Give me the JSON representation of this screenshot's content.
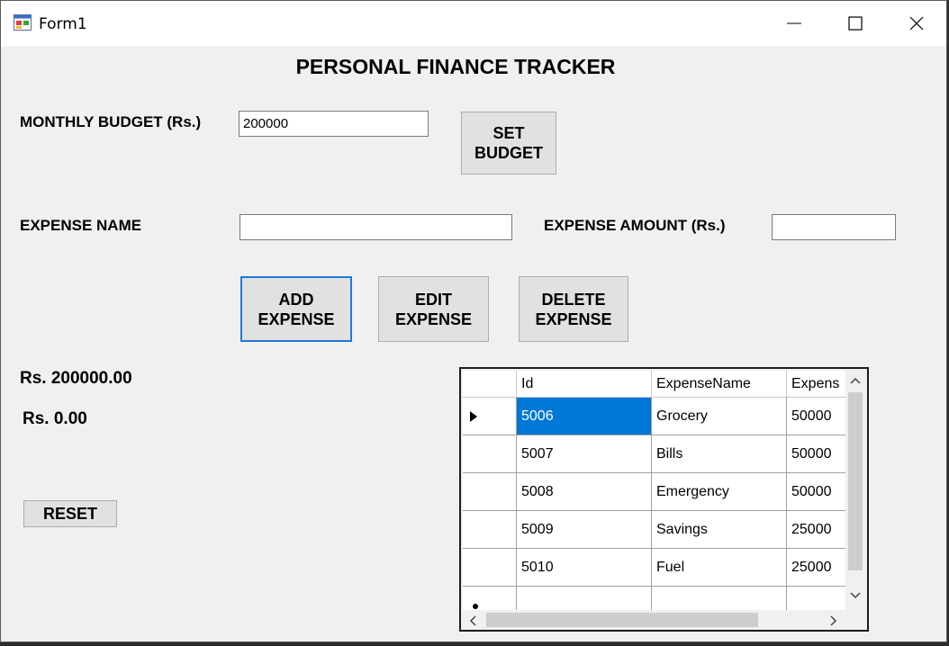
{
  "window": {
    "title": "Form1"
  },
  "heading": "PERSONAL FINANCE TRACKER",
  "budget": {
    "label": "MONTHLY BUDGET (Rs.)",
    "value": "200000",
    "set_button": "SET\nBUDGET"
  },
  "expense": {
    "name_label": "EXPENSE NAME",
    "name_value": "",
    "amount_label": "EXPENSE AMOUNT (Rs.)",
    "amount_value": ""
  },
  "actions": {
    "add": "ADD\nEXPENSE",
    "edit": "EDIT\nEXPENSE",
    "delete": "DELETE\nEXPENSE"
  },
  "summary": {
    "remaining": "Rs. 200000.00",
    "spent": "Rs. 0.00"
  },
  "reset_button": "RESET",
  "grid": {
    "columns": [
      "Id",
      "ExpenseName",
      "ExpenseAmount"
    ],
    "visible_columns": [
      "Id",
      "ExpenseName",
      "Expens"
    ],
    "rows": [
      {
        "id": "5006",
        "name": "Grocery",
        "amount": "50000"
      },
      {
        "id": "5007",
        "name": "Bills",
        "amount": "50000"
      },
      {
        "id": "5008",
        "name": "Emergency",
        "amount": "50000"
      },
      {
        "id": "5009",
        "name": "Savings",
        "amount": "25000"
      },
      {
        "id": "5010",
        "name": "Fuel",
        "amount": "25000"
      }
    ],
    "selected_row": 0
  },
  "icons": {
    "app": "form-app-icon",
    "minimize": "minimize-icon",
    "maximize": "maximize-icon",
    "close": "close-icon"
  },
  "colors": {
    "selection": "#0078d7",
    "focus_border": "#1e7ad8",
    "window_bg": "#f0f0f0"
  }
}
